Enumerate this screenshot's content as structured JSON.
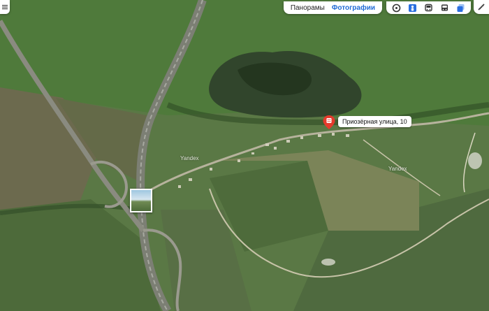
{
  "layers": {
    "panoramas_label": "Панорамы",
    "photos_label": "Фотографии"
  },
  "pin": {
    "label": "Приозёрная улица, 10",
    "color": "#e43a2c"
  },
  "place_labels": {
    "left": "Yandex",
    "right": "Yandex"
  },
  "icons": {
    "route": "route-icon",
    "panorama": "panorama-icon",
    "metro": "metro-icon",
    "bus": "bus-icon",
    "layers": "layers-icon",
    "ruler": "ruler-icon",
    "menu": "menu-icon"
  },
  "colors": {
    "active_tab": "#1f6ad6",
    "accent_blue": "#2b6fe0"
  }
}
